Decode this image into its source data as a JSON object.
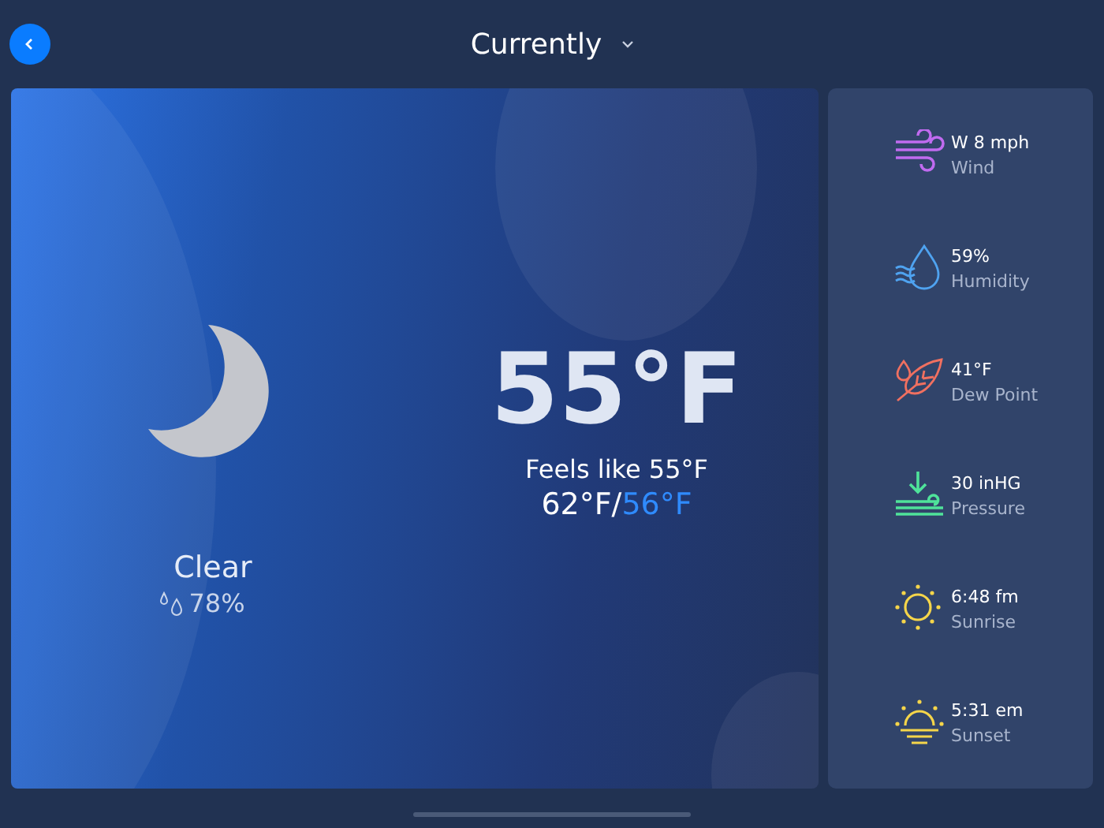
{
  "header": {
    "title": "Currently"
  },
  "current": {
    "condition": "Clear",
    "precipitation": "78%",
    "temperature": "55°F",
    "feels_like": "Feels like 55°F",
    "high": "62°F",
    "separator": "/",
    "low": "56°F"
  },
  "details": [
    {
      "kind": "wind",
      "color": "#c06bf0",
      "value": "W 8 mph",
      "label": "Wind"
    },
    {
      "kind": "humidity",
      "color": "#4fa3f0",
      "value": "59%",
      "label": "Humidity"
    },
    {
      "kind": "dewpoint",
      "color": "#f07060",
      "value": "41°F",
      "label": "Dew Point"
    },
    {
      "kind": "pressure",
      "color": "#4fe39a",
      "value": "30 inHG",
      "label": "Pressure"
    },
    {
      "kind": "sunrise",
      "color": "#f5d54a",
      "value": "6:48 fm",
      "label": "Sunrise"
    },
    {
      "kind": "sunset",
      "color": "#f5d54a",
      "value": "5:31 em",
      "label": "Sunset"
    }
  ]
}
